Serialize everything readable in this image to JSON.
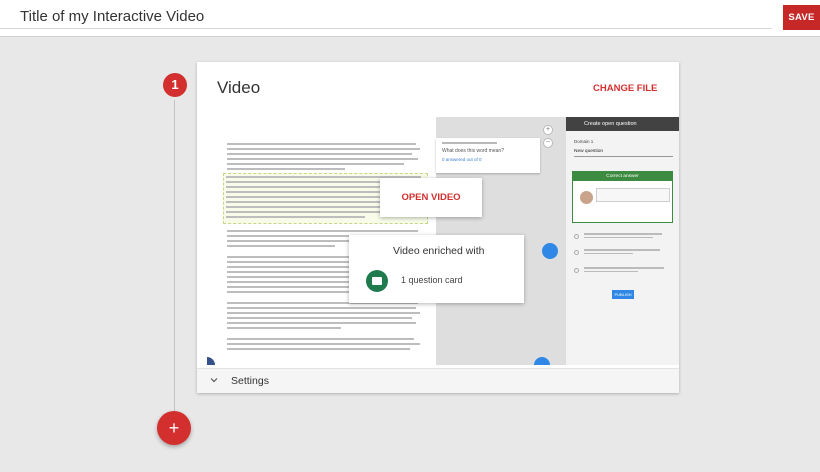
{
  "topbar": {
    "title_value": "Title of my Interactive Video",
    "save_label": "SAVE"
  },
  "timeline": {
    "step_number": "1",
    "add_label": "+"
  },
  "card": {
    "title": "Video",
    "change_file_label": "CHANGE FILE",
    "open_video_label": "OPEN VIDEO",
    "enriched_title": "Video enriched with",
    "enriched_count": "1 question card",
    "settings_label": "Settings"
  },
  "preview": {
    "question_card": {
      "question": "What does this word mean?",
      "link": "0 answered out of 0"
    },
    "side_panel": {
      "header": "Create open question",
      "question_field_label": "Domain 1",
      "question_value": "New question",
      "correct_answer_label": "Correct answer",
      "publish_label": "PUBLISH"
    }
  },
  "colors": {
    "accent_red": "#d32f2f",
    "save_red": "#c62828",
    "green": "#1f7a4d",
    "blue": "#2f88e6"
  },
  "icons": {
    "add": "plus-icon",
    "settings_toggle": "chevron-down-icon",
    "enriched": "question-card-icon"
  }
}
